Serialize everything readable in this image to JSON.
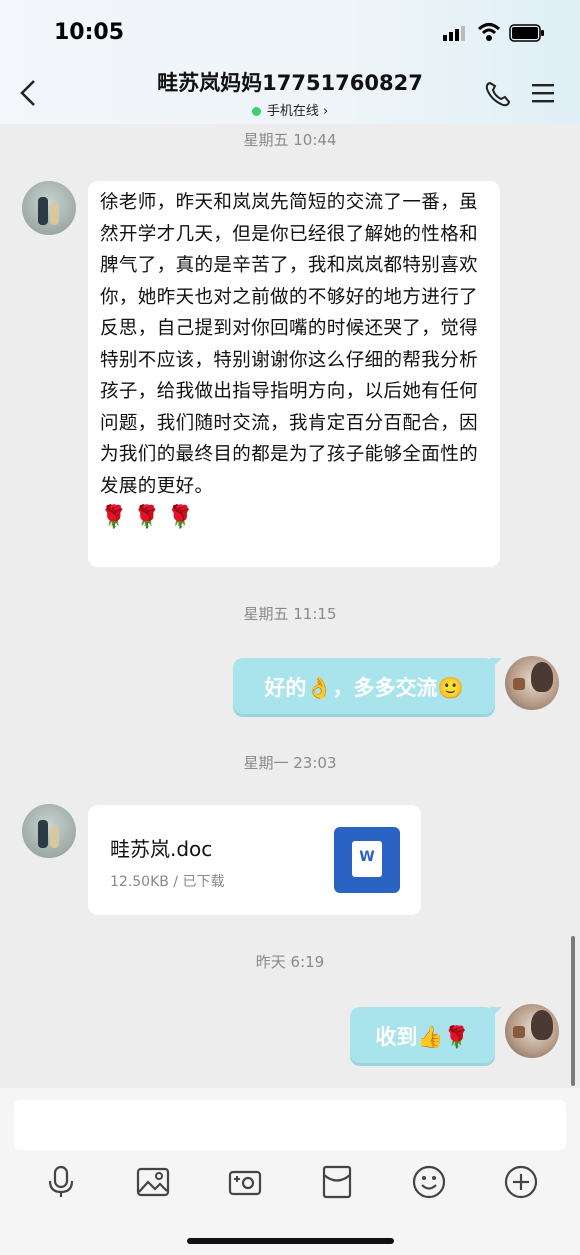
{
  "status_bar": {
    "time": "10:05"
  },
  "header": {
    "title": "畦苏岚妈妈17751760827",
    "presence": "手机在线",
    "presence_color": "#3bd16f"
  },
  "messages": {
    "ts1": "星期五 10:44",
    "long_text": "徐老师，昨天和岚岚先简短的交流了一番，虽然开学才几天，但是你已经很了解她的性格和脾气了，真的是辛苦了，我和岚岚都特别喜欢你，她昨天也对之前做的不够好的地方进行了反思，自己提到对你回嘴的时候还哭了，觉得特别不应该，特别谢谢你这么仔细的帮我分析孩子，给我做出指导指明方向，以后她有任何问题，我们随时交流，我肯定百分百配合，因为我们的最终目的都是为了孩子能够全面性的发展的更好。",
    "roses": "🌹🌹🌹",
    "ts2": "星期五 11:15",
    "reply1": "好的👌，多多交流🙂",
    "ts3": "星期一 23:03",
    "file": {
      "name": "畦苏岚.doc",
      "meta": "12.50KB / 已下载",
      "icon_letter": "W"
    },
    "ts4": "昨天 6:19",
    "reply2": "收到👍🌹"
  },
  "colors": {
    "bubble_self": "#a9e3ec",
    "word_icon": "#2b63c5"
  },
  "toolbar": {
    "icons": [
      "microphone-icon",
      "image-icon",
      "camera-icon",
      "red-packet-icon",
      "emoji-icon",
      "plus-icon"
    ]
  }
}
